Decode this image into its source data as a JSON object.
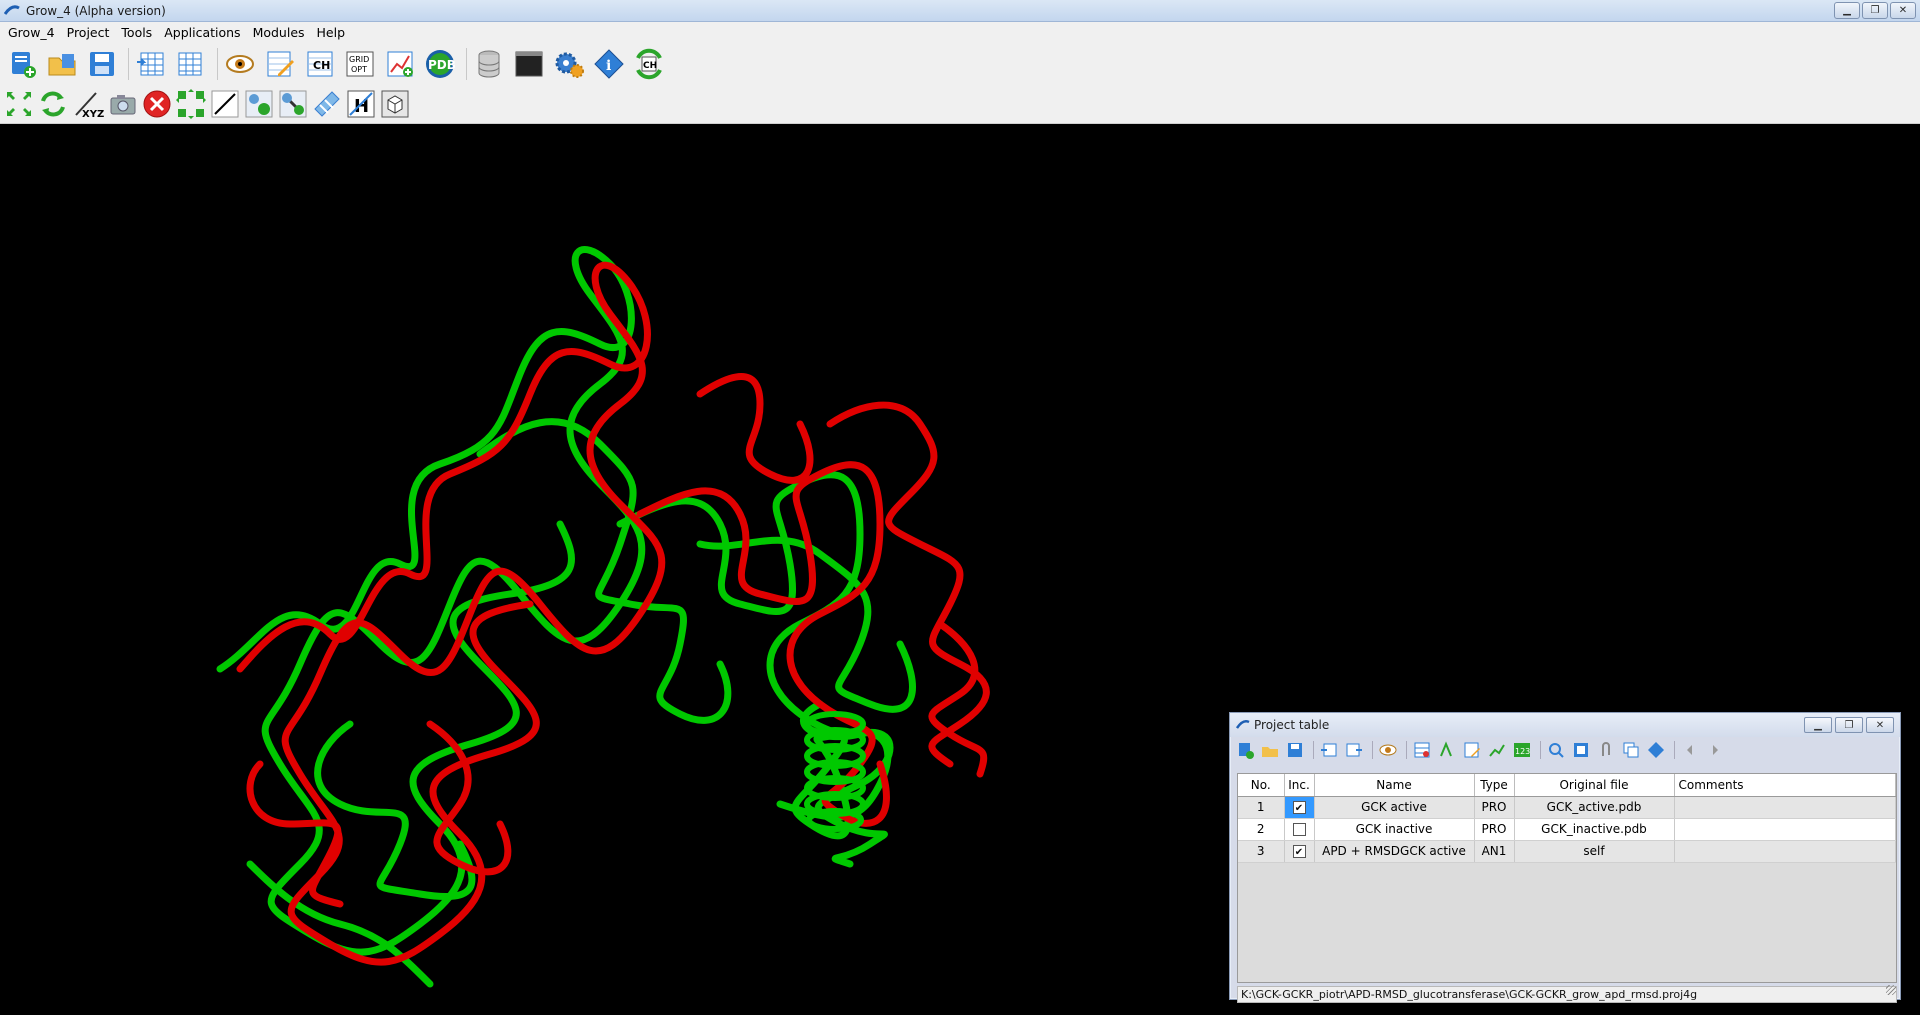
{
  "window": {
    "title": "Grow_4 (Alpha version)",
    "controls": [
      "minimize",
      "restore",
      "close"
    ]
  },
  "menu": [
    "Grow_4",
    "Project",
    "Tools",
    "Applications",
    "Modules",
    "Help"
  ],
  "toolbar": {
    "row1": [
      "new-project-icon",
      "open-project-icon",
      "save-project-icon",
      "import-table-icon",
      "export-table-icon",
      "view-icon",
      "edit-icon",
      "ch-icon",
      "grid-opt-icon",
      "add-graph-icon",
      "pdb-icon",
      "database-icon",
      "terminal-icon",
      "settings-gear-icon",
      "info-icon",
      "ch-refresh-icon"
    ],
    "row2": [
      "fit-view-icon",
      "rotate-icon",
      "xyz-axes-icon",
      "camera-icon",
      "close-red-icon",
      "expand-icon",
      "line-tool-icon",
      "atom-tool-icon",
      "bond-tool-icon",
      "ribbon-tool-icon",
      "hydrogen-icon",
      "box-icon"
    ],
    "labels": {
      "grid": "GRID OPT",
      "pdb": "PDB",
      "xyz": "XYZ",
      "ch": "CH",
      "h": "H"
    }
  },
  "colors": {
    "viewer_bg": "#000000",
    "ribbon_a": "#00cc00",
    "ribbon_b": "#e00000",
    "selection": "#3399ff"
  },
  "project_table": {
    "title": "Project table",
    "columns": [
      "No.",
      "Inc.",
      "Name",
      "Type",
      "Original file",
      "Comments"
    ],
    "rows": [
      {
        "no": "1",
        "inc": true,
        "name": "GCK active",
        "type": "PRO",
        "file": "GCK_active.pdb",
        "comments": ""
      },
      {
        "no": "2",
        "inc": false,
        "name": "GCK inactive",
        "type": "PRO",
        "file": "GCK_inactive.pdb",
        "comments": ""
      },
      {
        "no": "3",
        "inc": true,
        "name": "APD + RMSDGCK active",
        "type": "AN1",
        "file": "self",
        "comments": ""
      }
    ],
    "status_path": "K:\\GCK-GCKR_piotr\\APD-RMSD_glucotransferase\\GCK-GCKR_grow_apd_rmsd.proj4g"
  }
}
